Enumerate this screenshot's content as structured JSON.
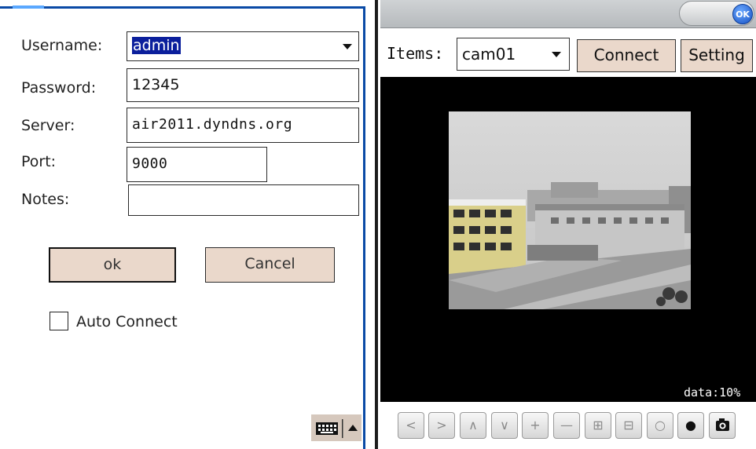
{
  "login_form": {
    "username_label": "Username:",
    "username_value": "admin",
    "password_label": "Password:",
    "password_value": "12345",
    "server_label": "Server:",
    "server_value": "air2011.dyndns.org",
    "port_label": "Port:",
    "port_value": "9000",
    "notes_label": "Notes:",
    "notes_value": "",
    "ok_label": "ok",
    "cancel_label": "Cancel",
    "auto_connect_label": "Auto Connect",
    "auto_connect_checked": false,
    "keyboard_icon": "keyboard-icon",
    "keyboard_toggle_icon": "triangle-up-icon"
  },
  "viewer": {
    "title_button": "OK",
    "items_label": "Items:",
    "camera_selected": "cam01",
    "connect_label": "Connect",
    "setting_label": "Setting",
    "data_rate": "data:10%",
    "controls": [
      {
        "icon": "pan-left-icon",
        "glyph": "<"
      },
      {
        "icon": "pan-right-icon",
        "glyph": ">"
      },
      {
        "icon": "tilt-up-icon",
        "glyph": "∧"
      },
      {
        "icon": "tilt-down-icon",
        "glyph": "∨"
      },
      {
        "icon": "zoom-in-icon",
        "glyph": "+"
      },
      {
        "icon": "zoom-out-icon",
        "glyph": "—"
      },
      {
        "icon": "focus-in-icon",
        "glyph": "⊞"
      },
      {
        "icon": "focus-out-icon",
        "glyph": "⊟"
      },
      {
        "icon": "record-ring-icon",
        "glyph": "○"
      },
      {
        "icon": "record-dot-icon",
        "glyph": "●"
      },
      {
        "icon": "camera-icon",
        "glyph": ""
      }
    ]
  },
  "colors": {
    "button_fill": "#ead8cb",
    "selection_highlight": "#0b1f9c",
    "window_border": "#0a4aa6"
  }
}
